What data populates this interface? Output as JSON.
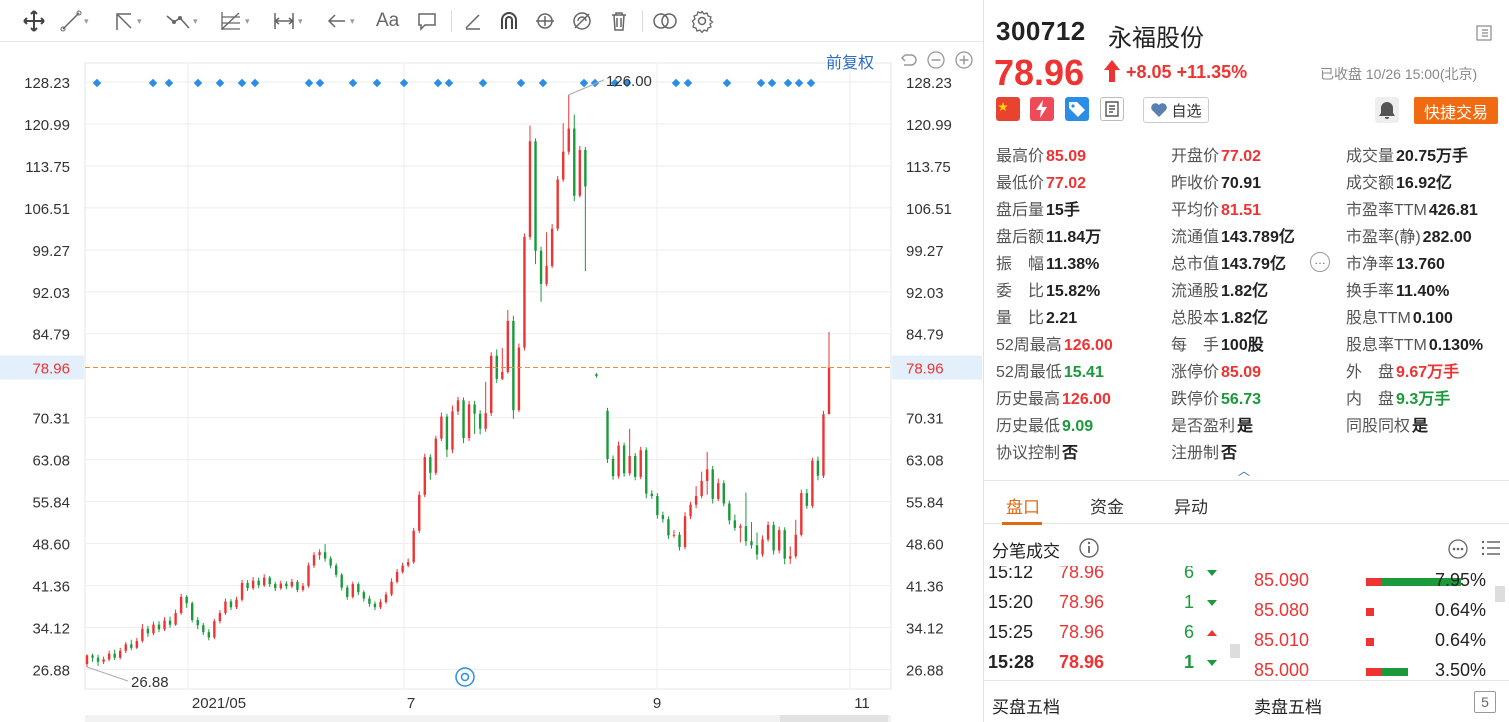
{
  "toolbar": {
    "icons": [
      "move-icon",
      "line-tool-icon",
      "ray-tool-icon",
      "polyline-tool-icon",
      "fib-tool-icon",
      "measure-tool-icon",
      "arrow-tool-icon",
      "text-tool-icon",
      "comment-tool-icon",
      "pen-tool-icon",
      "magnet-icon",
      "sync-icon",
      "hide-icon",
      "delete-icon",
      "compare-icon",
      "settings-icon"
    ],
    "text_tool_label": "Aa"
  },
  "chart": {
    "adjust_label": "前复权",
    "current_price_label": "78.96",
    "high_label": "126.00",
    "low_label": "26.88",
    "y_ticks": [
      "128.23",
      "120.99",
      "113.75",
      "106.51",
      "99.27",
      "92.03",
      "84.79",
      "70.31",
      "63.08",
      "55.84",
      "48.60",
      "41.36",
      "34.12",
      "26.88"
    ],
    "x_ticks": [
      "2021/05",
      "7",
      "9",
      "11"
    ],
    "colors": {
      "up": "#e33",
      "down": "#1a9a3a",
      "current_line": "#f08a2e",
      "marker": "#2b8ee6",
      "grid": "#eeeeee"
    }
  },
  "chart_data": {
    "type": "candlestick",
    "ylim": [
      23.5,
      131.5
    ],
    "x_ticks": [
      "2021/05",
      "7",
      "9",
      "11"
    ],
    "candles": [
      [
        27.8,
        29.3,
        27.3,
        29.5
      ],
      [
        29.3,
        28.9,
        28.2,
        29.6
      ],
      [
        28.9,
        28.2,
        27.5,
        29.4
      ],
      [
        28.2,
        28.6,
        27.8,
        29.1
      ],
      [
        28.6,
        29.6,
        28.3,
        30.1
      ],
      [
        29.6,
        28.9,
        28.5,
        30.3
      ],
      [
        28.9,
        30.1,
        28.6,
        30.6
      ],
      [
        30.1,
        31.2,
        29.7,
        31.6
      ],
      [
        31.2,
        30.6,
        30.2,
        32.0
      ],
      [
        30.6,
        31.8,
        30.4,
        32.3
      ],
      [
        31.8,
        33.9,
        31.5,
        34.7
      ],
      [
        33.9,
        33.1,
        32.5,
        34.4
      ],
      [
        33.1,
        34.6,
        32.8,
        35.1
      ],
      [
        34.6,
        33.8,
        33.3,
        35.2
      ],
      [
        33.8,
        35.3,
        33.5,
        35.9
      ],
      [
        35.3,
        34.6,
        34.1,
        36.0
      ],
      [
        34.6,
        36.6,
        34.4,
        37.2
      ],
      [
        36.6,
        39.4,
        36.3,
        39.9
      ],
      [
        39.4,
        38.3,
        37.5,
        39.7
      ],
      [
        38.3,
        35.4,
        35.0,
        38.6
      ],
      [
        35.4,
        34.5,
        33.8,
        35.9
      ],
      [
        34.5,
        33.3,
        32.8,
        34.9
      ],
      [
        33.3,
        32.4,
        31.9,
        33.8
      ],
      [
        32.4,
        35.2,
        32.1,
        35.6
      ],
      [
        35.2,
        36.6,
        34.8,
        37.1
      ],
      [
        36.6,
        38.6,
        36.3,
        39.1
      ],
      [
        38.6,
        37.6,
        37.1,
        39.0
      ],
      [
        37.6,
        38.9,
        37.3,
        39.4
      ],
      [
        38.9,
        41.8,
        38.6,
        42.3
      ],
      [
        41.8,
        40.9,
        40.4,
        42.3
      ],
      [
        40.9,
        42.2,
        40.6,
        42.8
      ],
      [
        42.2,
        41.4,
        40.9,
        42.7
      ],
      [
        41.4,
        42.7,
        41.1,
        43.3
      ],
      [
        42.7,
        41.6,
        41.1,
        43.0
      ],
      [
        41.6,
        40.9,
        40.4,
        42.0
      ],
      [
        40.9,
        41.7,
        40.6,
        42.2
      ],
      [
        41.7,
        41.2,
        40.7,
        42.1
      ],
      [
        41.2,
        42.0,
        40.9,
        42.5
      ],
      [
        42.0,
        40.6,
        40.2,
        42.3
      ],
      [
        40.6,
        41.3,
        40.3,
        41.8
      ],
      [
        41.3,
        44.8,
        41.0,
        45.3
      ],
      [
        44.8,
        46.6,
        44.4,
        47.1
      ],
      [
        46.6,
        47.1,
        45.8,
        47.6
      ],
      [
        47.1,
        46.0,
        45.5,
        48.5
      ],
      [
        46.0,
        44.8,
        44.3,
        46.4
      ],
      [
        44.8,
        43.2,
        42.8,
        45.2
      ],
      [
        43.2,
        41.0,
        40.5,
        43.5
      ],
      [
        41.0,
        39.4,
        38.9,
        41.4
      ],
      [
        39.4,
        41.6,
        39.1,
        42.0
      ],
      [
        41.6,
        40.2,
        39.7,
        41.9
      ],
      [
        40.2,
        39.1,
        38.6,
        40.5
      ],
      [
        39.1,
        38.2,
        37.7,
        39.6
      ],
      [
        38.2,
        37.6,
        37.1,
        38.6
      ],
      [
        37.6,
        38.5,
        37.3,
        39.0
      ],
      [
        38.5,
        39.8,
        38.2,
        40.3
      ],
      [
        39.8,
        42.0,
        39.5,
        42.6
      ],
      [
        42.0,
        43.7,
        41.7,
        44.2
      ],
      [
        43.7,
        44.8,
        43.4,
        45.3
      ],
      [
        44.8,
        45.4,
        44.5,
        46.0
      ],
      [
        45.4,
        50.8,
        45.1,
        51.3
      ],
      [
        50.8,
        57.0,
        50.4,
        57.6
      ],
      [
        57.0,
        63.5,
        56.6,
        64.1
      ],
      [
        63.5,
        60.8,
        59.6,
        64.0
      ],
      [
        60.8,
        66.7,
        60.4,
        67.2
      ],
      [
        66.7,
        70.5,
        66.3,
        71.2
      ],
      [
        70.5,
        64.8,
        63.5,
        71.0
      ],
      [
        64.8,
        71.4,
        64.2,
        72.4
      ],
      [
        71.4,
        73.3,
        70.8,
        73.9
      ],
      [
        73.3,
        66.8,
        65.9,
        73.8
      ],
      [
        66.8,
        72.6,
        66.3,
        73.2
      ],
      [
        72.6,
        71.0,
        67.5,
        73.2
      ],
      [
        71.0,
        68.4,
        67.4,
        71.6
      ],
      [
        68.4,
        71.1,
        67.9,
        76.5
      ],
      [
        71.1,
        81.0,
        70.6,
        81.6
      ],
      [
        81.0,
        77.0,
        76.3,
        82.1
      ],
      [
        77.0,
        78.2,
        76.8,
        82.3
      ],
      [
        78.2,
        87.0,
        77.9,
        88.9
      ],
      [
        87.0,
        71.6,
        70.1,
        87.9
      ],
      [
        71.6,
        82.4,
        71.3,
        83.1
      ],
      [
        82.4,
        101.5,
        81.9,
        102.1
      ],
      [
        101.5,
        118.0,
        101.0,
        120.7
      ],
      [
        118.0,
        99.1,
        96.8,
        118.5
      ],
      [
        99.1,
        93.4,
        90.3,
        99.8
      ],
      [
        93.4,
        96.5,
        93.0,
        102.3
      ],
      [
        96.5,
        102.9,
        96.1,
        103.7
      ],
      [
        102.9,
        111.4,
        102.5,
        112.0
      ],
      [
        111.4,
        116.2,
        111.0,
        121.1
      ],
      [
        116.2,
        120.2,
        115.7,
        126.0
      ],
      [
        120.2,
        108.6,
        107.7,
        122.6
      ],
      [
        108.6,
        116.5,
        108.3,
        117.2
      ],
      [
        116.5,
        110.2,
        95.6,
        117.0
      ],
      [
        null,
        null,
        null,
        null
      ],
      [
        77.8,
        77.5,
        77.2,
        78.0
      ],
      [
        null,
        null,
        null,
        null
      ],
      [
        71.5,
        63.2,
        62.5,
        72.0
      ],
      [
        63.2,
        60.2,
        59.6,
        63.8
      ],
      [
        60.2,
        65.5,
        59.8,
        66.2
      ],
      [
        65.5,
        60.7,
        60.1,
        66.0
      ],
      [
        60.7,
        63.7,
        60.3,
        68.4
      ],
      [
        63.7,
        60.1,
        59.5,
        64.2
      ],
      [
        60.1,
        64.7,
        59.7,
        65.3
      ],
      [
        64.7,
        57.2,
        56.4,
        65.2
      ],
      [
        57.2,
        56.8,
        56.3,
        57.8
      ],
      [
        56.8,
        53.5,
        52.9,
        57.3
      ],
      [
        53.5,
        52.8,
        52.2,
        54.1
      ],
      [
        52.8,
        50.0,
        49.4,
        53.3
      ],
      [
        50.0,
        50.1,
        49.6,
        50.9
      ],
      [
        50.1,
        48.0,
        47.4,
        50.6
      ],
      [
        48.0,
        53.3,
        47.6,
        54.0
      ],
      [
        53.3,
        55.3,
        52.8,
        55.8
      ],
      [
        55.3,
        56.8,
        54.7,
        58.5
      ],
      [
        56.8,
        59.4,
        56.4,
        61.0
      ],
      [
        59.4,
        61.4,
        57.0,
        64.4
      ],
      [
        61.4,
        56.3,
        55.5,
        62.0
      ],
      [
        56.3,
        59.0,
        55.9,
        59.8
      ],
      [
        59.0,
        55.5,
        55.0,
        59.5
      ],
      [
        55.5,
        52.6,
        51.9,
        56.0
      ],
      [
        52.6,
        51.3,
        50.8,
        53.6
      ],
      [
        51.3,
        51.6,
        48.8,
        52.0
      ],
      [
        51.6,
        49.0,
        48.2,
        57.4
      ],
      [
        49.0,
        48.3,
        47.7,
        52.3
      ],
      [
        48.3,
        46.7,
        45.8,
        50.5
      ],
      [
        46.7,
        49.3,
        46.3,
        50.0
      ],
      [
        49.3,
        51.8,
        48.9,
        52.4
      ],
      [
        51.8,
        47.4,
        46.7,
        52.4
      ],
      [
        47.4,
        50.9,
        46.9,
        51.5
      ],
      [
        50.9,
        46.0,
        45.0,
        51.4
      ],
      [
        46.0,
        46.4,
        45.1,
        48.1
      ],
      [
        46.4,
        50.1,
        46.0,
        52.7
      ],
      [
        50.1,
        57.3,
        49.8,
        57.9
      ],
      [
        57.3,
        55.1,
        54.6,
        58.0
      ],
      [
        55.1,
        62.9,
        54.7,
        63.4
      ],
      [
        62.9,
        60.3,
        59.5,
        63.6
      ],
      [
        60.3,
        70.9,
        59.9,
        71.5
      ],
      [
        70.9,
        78.96,
        77.02,
        85.09
      ]
    ]
  },
  "quote": {
    "code": "300712",
    "name": "永福股份",
    "price": "78.96",
    "change": "+8.05",
    "change_pct": "+11.35%",
    "status": "已收盘 10/26 15:00(北京)",
    "fav_label": "自选",
    "trade_label": "快捷交易",
    "more_label": "…"
  },
  "stats": {
    "col1": [
      {
        "label": "最高价",
        "value": "85.09",
        "color": "red"
      },
      {
        "label": "最低价",
        "value": "77.02",
        "color": "red"
      },
      {
        "label": "盘后量",
        "value": "15手",
        "color": "dark"
      },
      {
        "label": "盘后额",
        "value": "11.84万",
        "color": "dark"
      },
      {
        "label": "振　幅",
        "value": "11.38%",
        "color": "dark"
      },
      {
        "label": "委　比",
        "value": "15.82%",
        "color": "dark"
      },
      {
        "label": "量　比",
        "value": "2.21",
        "color": "dark"
      },
      {
        "label": "52周最高",
        "value": "126.00",
        "color": "red"
      },
      {
        "label": "52周最低",
        "value": "15.41",
        "color": "green"
      },
      {
        "label": "历史最高",
        "value": "126.00",
        "color": "red"
      },
      {
        "label": "历史最低",
        "value": "9.09",
        "color": "green"
      },
      {
        "label": "协议控制",
        "value": "否",
        "color": "dark"
      }
    ],
    "col2": [
      {
        "label": "开盘价",
        "value": "77.02",
        "color": "red"
      },
      {
        "label": "昨收价",
        "value": "70.91",
        "color": "dark"
      },
      {
        "label": "平均价",
        "value": "81.51",
        "color": "red"
      },
      {
        "label": "流通值",
        "value": "143.789亿",
        "color": "dark"
      },
      {
        "label": "总市值",
        "value": "143.79亿",
        "color": "dark"
      },
      {
        "label": "流通股",
        "value": "1.82亿",
        "color": "dark"
      },
      {
        "label": "总股本",
        "value": "1.82亿",
        "color": "dark"
      },
      {
        "label": "每　手",
        "value": "100股",
        "color": "dark"
      },
      {
        "label": "涨停价",
        "value": "85.09",
        "color": "red"
      },
      {
        "label": "跌停价",
        "value": "56.73",
        "color": "green"
      },
      {
        "label": "是否盈利",
        "value": "是",
        "color": "dark"
      },
      {
        "label": "注册制",
        "value": "否",
        "color": "dark"
      }
    ],
    "col3": [
      {
        "label": "成交量",
        "value": "20.75万手",
        "color": "dark"
      },
      {
        "label": "成交额",
        "value": "16.92亿",
        "color": "dark"
      },
      {
        "label": "市盈率TTM",
        "value": "426.81",
        "color": "dark"
      },
      {
        "label": "市盈率(静)",
        "value": "282.00",
        "color": "dark"
      },
      {
        "label": "市净率",
        "value": "13.760",
        "color": "dark"
      },
      {
        "label": "换手率",
        "value": "11.40%",
        "color": "dark"
      },
      {
        "label": "股息TTM",
        "value": "0.100",
        "color": "dark"
      },
      {
        "label": "股息率TTM",
        "value": "0.130%",
        "color": "dark"
      },
      {
        "label": "外　盘",
        "value": "9.67万手",
        "color": "red"
      },
      {
        "label": "内　盘",
        "value": "9.3万手",
        "color": "green"
      },
      {
        "label": "同股同权",
        "value": "是",
        "color": "dark"
      }
    ]
  },
  "tabs": [
    "盘口",
    "资金",
    "异动"
  ],
  "ticks": {
    "title": "分笔成交",
    "rows": [
      {
        "time": "15:12",
        "price": "78.96",
        "vol": "6",
        "dir": "down"
      },
      {
        "time": "15:20",
        "price": "78.96",
        "vol": "1",
        "dir": "down"
      },
      {
        "time": "15:25",
        "price": "78.96",
        "vol": "6",
        "dir": "up"
      },
      {
        "time": "15:28",
        "price": "78.96",
        "vol": "1",
        "dir": "down"
      }
    ]
  },
  "asks": {
    "rows": [
      {
        "price": "85.090",
        "pct": "7.95%",
        "fill": 0.795
      },
      {
        "price": "85.080",
        "pct": "0.64%",
        "fill": 0.064
      },
      {
        "price": "85.010",
        "pct": "0.64%",
        "fill": 0.064
      },
      {
        "price": "85.000",
        "pct": "3.50%",
        "fill": 0.35
      }
    ]
  },
  "bottom": {
    "bid_title": "买盘五档",
    "ask_title": "卖盘五档",
    "five_label": "5"
  }
}
